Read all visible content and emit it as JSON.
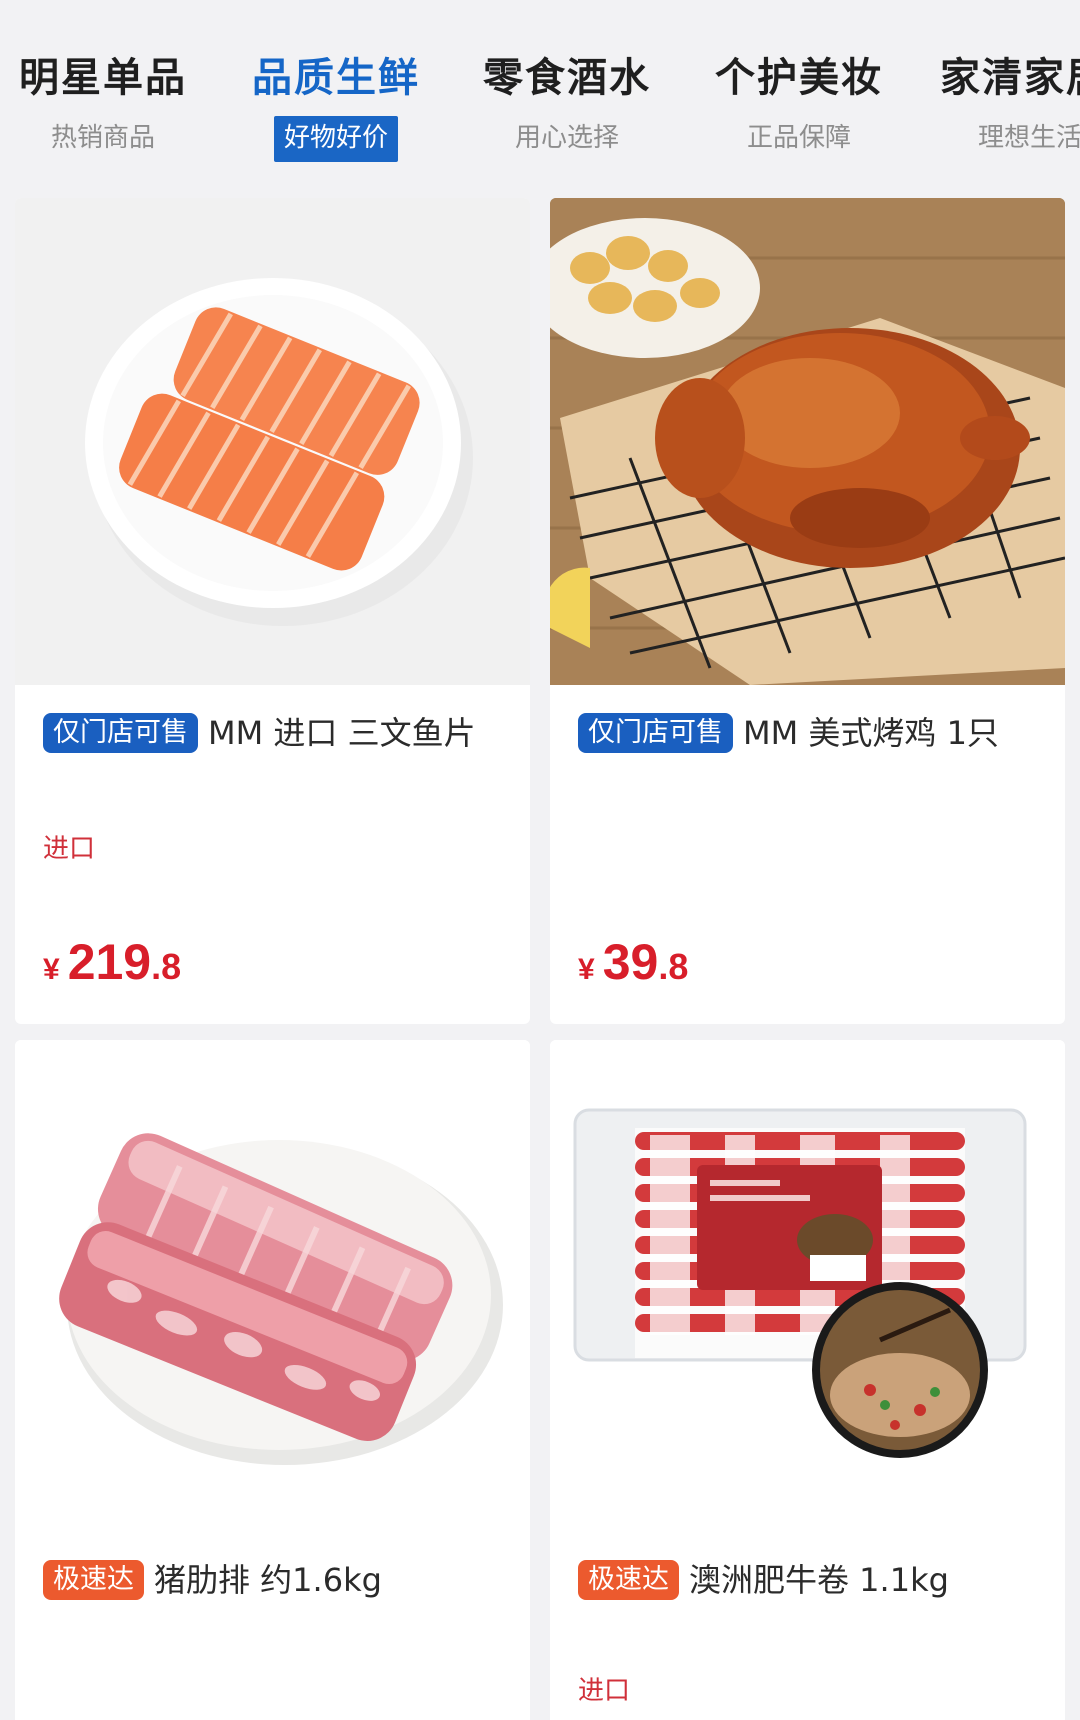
{
  "tabs": [
    {
      "title": "明星单品",
      "sub": "热销商品",
      "active": false
    },
    {
      "title": "品质生鲜",
      "sub": "好物好价",
      "active": true
    },
    {
      "title": "零食酒水",
      "sub": "用心选择",
      "active": false
    },
    {
      "title": "个护美妆",
      "sub": "正品保障",
      "active": false
    },
    {
      "title": "家清家居",
      "sub": "理想生活",
      "active": false
    }
  ],
  "products": [
    {
      "badge": "仅门店可售",
      "name": "MM 进口 三文鱼片",
      "tag": "进口",
      "currency": "¥",
      "price_int": "219",
      "price_dec": ".8"
    },
    {
      "badge": "仅门店可售",
      "name": "MM 美式烤鸡 1只",
      "tag": "",
      "currency": "¥",
      "price_int": "39",
      "price_dec": ".8"
    },
    {
      "badge": "极速达",
      "name": "猪肋排 约1.6kg",
      "tag": "",
      "currency": "",
      "price_int": "",
      "price_dec": ""
    },
    {
      "badge": "极速达",
      "name": "澳洲肥牛卷 1.1kg",
      "tag": "进口",
      "currency": "",
      "price_int": "",
      "price_dec": ""
    }
  ],
  "colors": {
    "accent_blue": "#1566c7",
    "badge_blue": "#1a5fc0",
    "badge_orange": "#ec5a2e",
    "price_red": "#d81e2a"
  }
}
